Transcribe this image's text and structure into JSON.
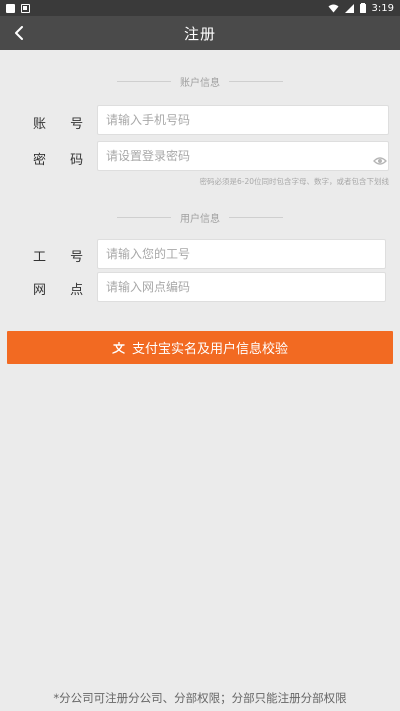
{
  "status_bar": {
    "time": "3:19"
  },
  "header": {
    "title": "注册",
    "back_icon": "chevron-left-icon"
  },
  "account_section": {
    "title": "账户信息",
    "account_label": "账 号",
    "account_placeholder": "请输入手机号码",
    "password_label": "密 码",
    "password_placeholder": "请设置登录密码",
    "password_hint": "密码必须是6-20位同时包含字母、数字，或者包含下划线"
  },
  "user_section": {
    "title": "用户信息",
    "employee_label": "工 号",
    "employee_placeholder": "请输入您的工号",
    "outlet_label": "网 点",
    "outlet_placeholder": "请输入网点编码"
  },
  "verify_button": {
    "label": "支付宝实名及用户信息校验",
    "icon": "alipay-icon"
  },
  "footer": {
    "note": "*分公司可注册分公司、分部权限；分部只能注册分部权限"
  },
  "colors": {
    "accent": "#f26a22",
    "app_bar": "#4a4a4a",
    "background": "#ebebeb"
  }
}
